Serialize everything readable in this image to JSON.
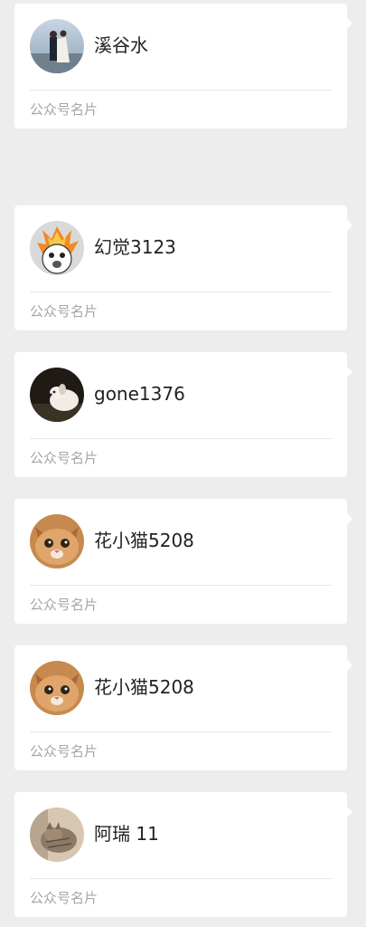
{
  "messages": [
    {
      "name": "溪谷水",
      "label": "公众号名片",
      "avatar": "couple-photo"
    },
    {
      "name": "幻觉3123",
      "label": "公众号名片",
      "avatar": "meme-cartoon"
    },
    {
      "name": "gone1376",
      "label": "公众号名片",
      "avatar": "dog-photo"
    },
    {
      "name": "花小猫5208",
      "label": "公众号名片",
      "avatar": "cat-photo"
    },
    {
      "name": "花小猫5208",
      "label": "公众号名片",
      "avatar": "cat-photo"
    },
    {
      "name": "阿瑞 11",
      "label": "公众号名片",
      "avatar": "kitten-photo"
    }
  ]
}
